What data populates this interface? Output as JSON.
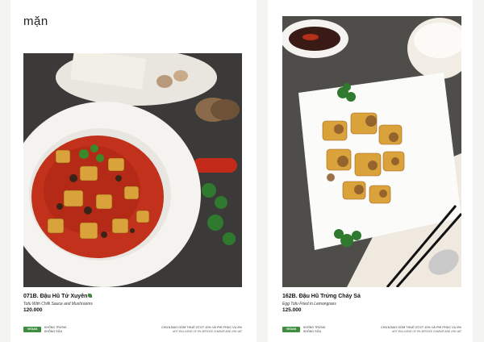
{
  "section": {
    "title": "mặn"
  },
  "dishes": [
    {
      "code_name": "071B. Đậu Hũ Tứ Xuyên",
      "english": "Tofu With Chilli Sauce and Mushrooms",
      "price": "120.000",
      "vegan_label": "VEGAN",
      "vegan_note": "KHÔNG TRỨNG KHÔNG SỮA",
      "tax_vi": "CHƯA BAO GỒM THUẾ GTGT 10% VÀ PHÍ PHỤC VỤ 5%",
      "tax_en": "NOT INCLUSIVE OF 5% SERVICE CHARGE AND 10% VAT"
    },
    {
      "code_name": "162B. Đậu Hũ Trứng Cháy Sả",
      "english": "Egg Tofu Fried in Lemongrass",
      "price": "125.000",
      "vegan_label": "VEGAN",
      "vegan_note": "KHÔNG TRỨNG KHÔNG SỮA",
      "tax_vi": "CHƯA BAO GỒM THUẾ GTGT 10% VÀ PHÍ PHỤC VỤ 5%",
      "tax_en": "NOT INCLUSIVE OF 5% SERVICE CHARGE AND 10% VAT"
    }
  ],
  "colors": {
    "vegan_green": "#3e8e3e",
    "sauce_red": "#c2311b",
    "tofu_gold": "#d9a23a"
  }
}
